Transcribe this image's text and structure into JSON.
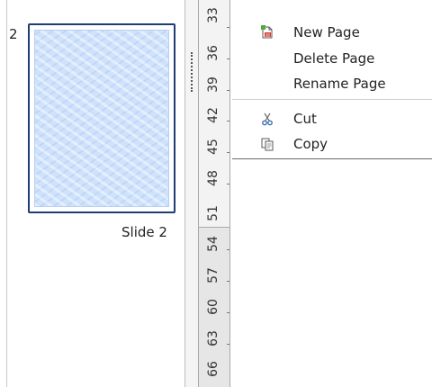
{
  "slide_panel": {
    "slide_number": "2",
    "slide_name": "Slide 2"
  },
  "ruler": {
    "labels": [
      "33",
      "36",
      "39",
      "42",
      "45",
      "48",
      "51",
      "54",
      "57",
      "60",
      "63",
      "66"
    ]
  },
  "context_menu": {
    "items": [
      {
        "label": "New Page",
        "icon": "new-page-icon"
      },
      {
        "label": "Delete Page"
      },
      {
        "label": "Rename Page"
      },
      {
        "label": "Cut",
        "icon": "scissors-icon"
      },
      {
        "label": "Copy",
        "icon": "copy-icon"
      }
    ]
  },
  "colors": {
    "selection_border": "#1f3d73",
    "slide_background": "#cfe2fb"
  }
}
